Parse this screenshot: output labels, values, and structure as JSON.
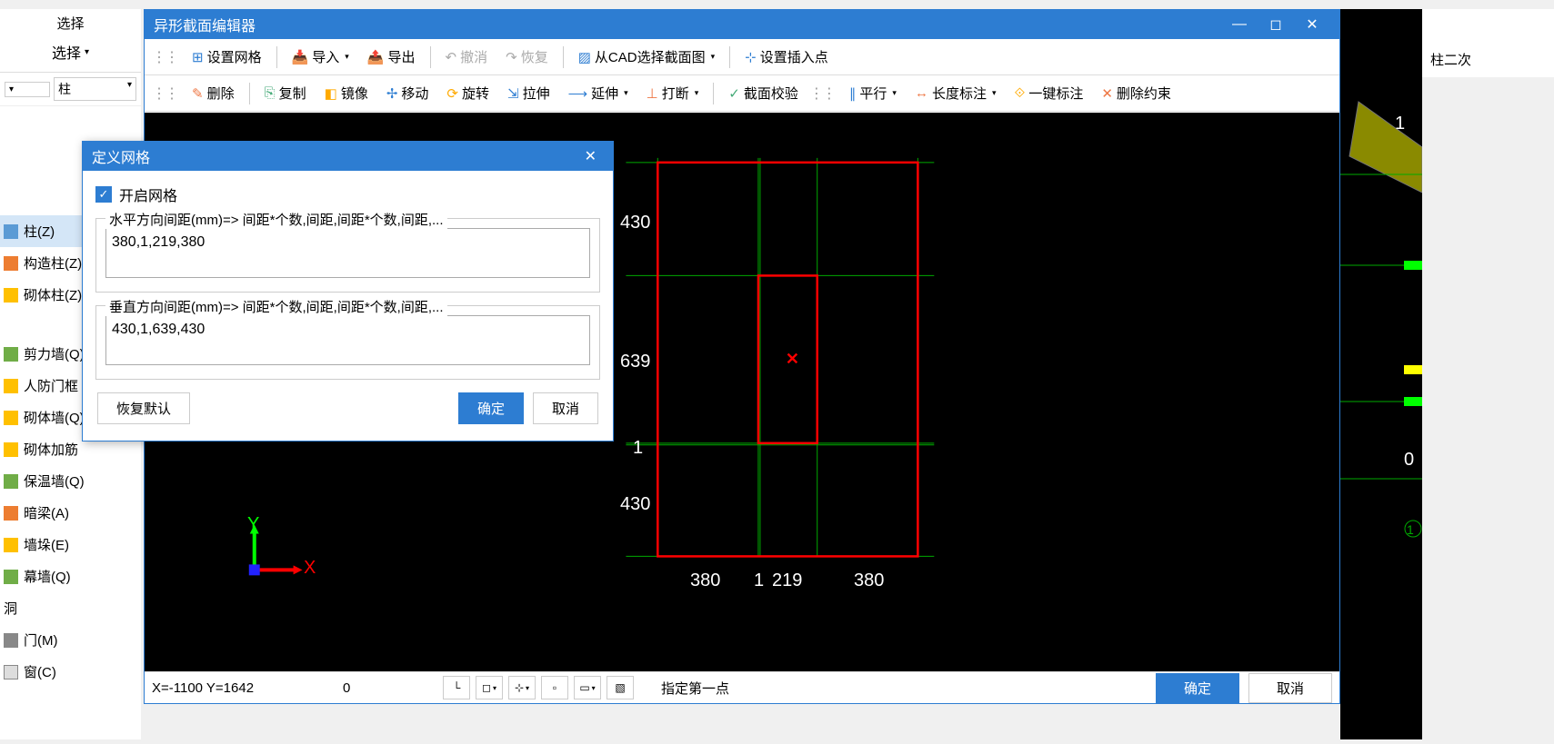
{
  "left_panel": {
    "select_header": "选择",
    "select_btn": "选择",
    "filter_value": "柱",
    "tree": [
      {
        "label": "柱(Z)",
        "icon": "icon-pillar",
        "selected": true
      },
      {
        "label": "构造柱(Z)",
        "icon": "icon-struct"
      },
      {
        "label": "砌体柱(Z)",
        "icon": "icon-wall"
      },
      {
        "label": "剪力墙(Q)",
        "icon": "icon-wall2"
      },
      {
        "label": "人防门框",
        "icon": "icon-wall"
      },
      {
        "label": "砌体墙(Q)",
        "icon": "icon-wall"
      },
      {
        "label": "砌体加筋",
        "icon": "icon-wall"
      },
      {
        "label": "保温墙(Q)",
        "icon": "icon-wall2"
      },
      {
        "label": "暗梁(A)",
        "icon": "icon-struct"
      },
      {
        "label": "墙垛(E)",
        "icon": "icon-wall"
      },
      {
        "label": "幕墙(Q)",
        "icon": "icon-wall2"
      },
      {
        "label": "洞",
        "icon": "icon-door"
      },
      {
        "label": "门(M)",
        "icon": "icon-door"
      },
      {
        "label": "窗(C)",
        "icon": "icon-window"
      }
    ]
  },
  "editor": {
    "title": "异形截面编辑器",
    "toolbar1": {
      "set_grid": "设置网格",
      "import": "导入",
      "export": "导出",
      "undo": "撤消",
      "redo": "恢复",
      "from_cad": "从CAD选择截面图",
      "set_insert": "设置插入点"
    },
    "toolbar2": {
      "delete": "删除",
      "copy": "复制",
      "mirror": "镜像",
      "move": "移动",
      "rotate": "旋转",
      "stretch": "拉伸",
      "extend": "延伸",
      "break": "打断",
      "validate": "截面校验",
      "parallel": "平行",
      "dim_length": "长度标注",
      "one_click": "一键标注",
      "del_constraint": "删除约束"
    }
  },
  "dialog": {
    "title": "定义网格",
    "enable_grid": "开启网格",
    "h_label": "水平方向间距(mm)=> 间距*个数,间距,间距*个数,间距,...",
    "h_value": "380,1,219,380",
    "v_label": "垂直方向间距(mm)=> 间距*个数,间距,间距*个数,间距,...",
    "v_value": "430,1,639,430",
    "restore": "恢复默认",
    "ok": "确定",
    "cancel": "取消"
  },
  "canvas": {
    "h_dims": [
      "380",
      "1",
      "219",
      "380"
    ],
    "v_dims": [
      "430",
      "639",
      "1",
      "430"
    ],
    "axis_x": "X",
    "axis_y": "Y"
  },
  "status": {
    "coords": "X=-1100 Y=1642",
    "zero": "0",
    "prompt": "指定第一点",
    "ok": "确定",
    "cancel": "取消"
  },
  "far_right": {
    "tab": "柱二次"
  }
}
